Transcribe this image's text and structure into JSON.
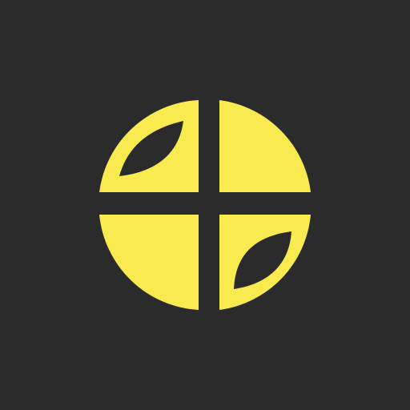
{
  "logo": {
    "name": "quartered-circle-leaf-logo",
    "colors": {
      "background": "#2b2b2b",
      "mark": "#f8ea4f",
      "cutout": "#2b2b2b"
    }
  }
}
